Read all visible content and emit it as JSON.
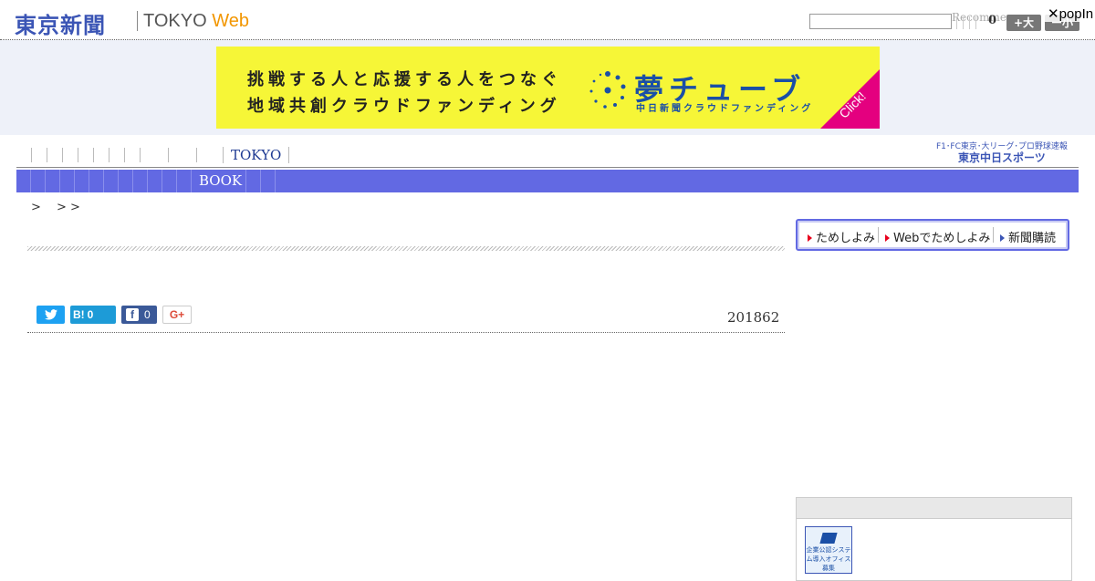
{
  "header": {
    "logo_jp": "東京新聞",
    "logo_en_prefix": "TOKYO ",
    "logo_en_suffix": "Web",
    "recommend_text": "Recommen",
    "count": "0",
    "font_large_label": "+大",
    "font_small_label": "ー小",
    "popin_label": "✕popIn"
  },
  "banner": {
    "line1": "挑戦する人と応援する人をつなぐ",
    "line2": "地域共創クラウドファンディング",
    "title": "夢チューブ",
    "subtitle": "中日新聞クラウドファンディング",
    "click": "Click!"
  },
  "nav_primary": {
    "tokyo_label": "TOKYO"
  },
  "chunichi": {
    "line1": "F1･FC東京･大リーグ･プロ野球速報",
    "line2": "東京中日スポーツ"
  },
  "nav_secondary": {
    "book_label": "BOOK"
  },
  "breadcrumb": {
    "text": ">　 > >"
  },
  "share": {
    "twitter_icon": "twitter-bird",
    "hatena_label": "B!",
    "hatena_count": "0",
    "facebook_icon": "f",
    "facebook_count": "0",
    "gplus_label": "G+"
  },
  "article": {
    "date": "201862"
  },
  "sidebar": {
    "subscribe": {
      "item1": "ためしよみ",
      "item2": "Webでためしよみ",
      "item3": "新聞購読"
    },
    "ad_label": "企業公認システム導入オフィス募集"
  },
  "colors": {
    "brand_blue": "#3b55b5",
    "nav_bar": "#6269e3",
    "banner_yellow": "#f6f637",
    "web_orange": "#f29600",
    "click_magenta": "#e4007f"
  }
}
